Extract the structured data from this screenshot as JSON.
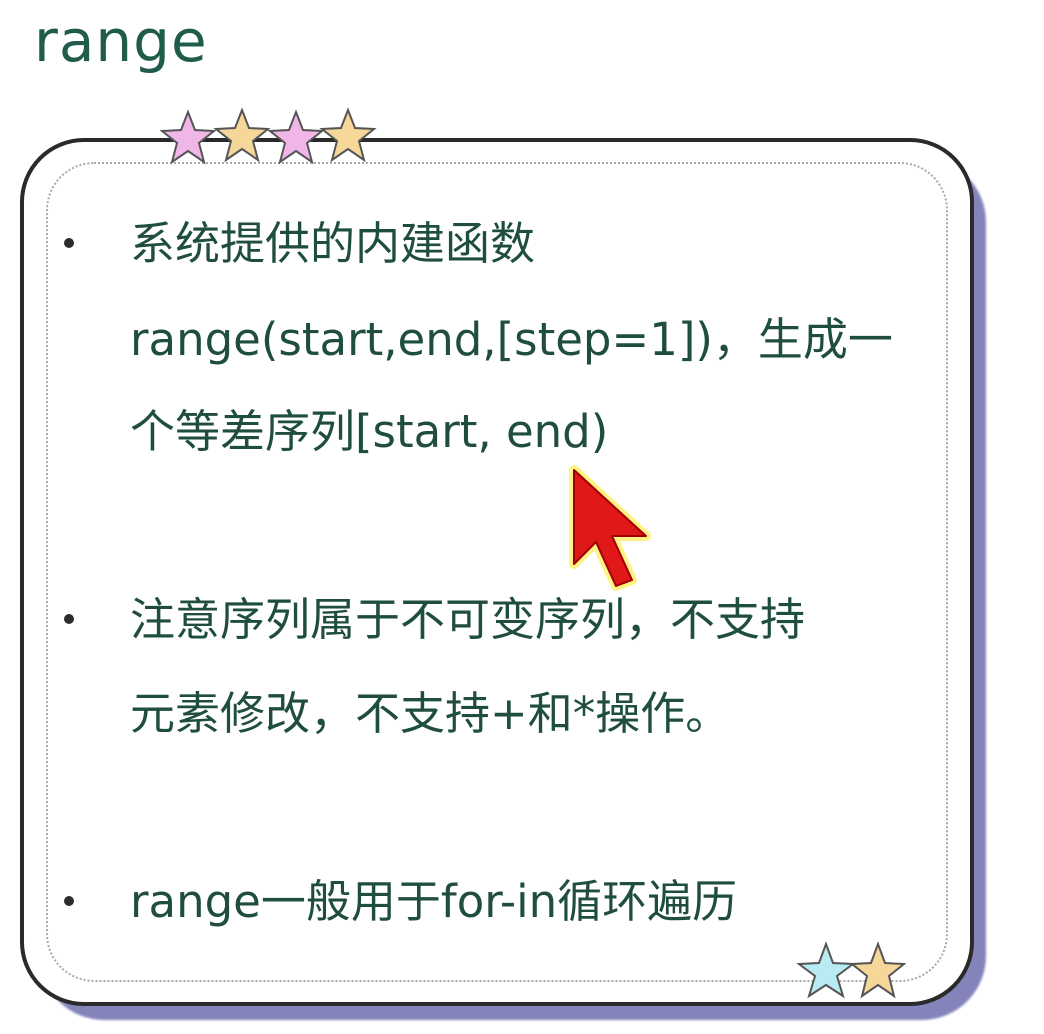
{
  "slide": {
    "title": "range",
    "bullets": [
      {
        "lines": [
          "系统提供的内建函数",
          "range(start,end,[step=1])，生成一",
          "个等差序列[start, end)"
        ]
      },
      {
        "lines": [
          "注意序列属于不可变序列，不支持",
          "元素修改，不支持+和*操作。"
        ]
      },
      {
        "lines": [
          "range一般用于for-in循环遍历"
        ]
      }
    ]
  },
  "colors": {
    "title": "#1f5c4b",
    "text": "#1f4d3f",
    "card_border": "#2a2a2a",
    "card_shadow": "#6f6fb0",
    "star_pink": "#f0b6e8",
    "star_yellow": "#f5d79a",
    "star_cyan": "#b8ecf2",
    "cursor_fill": "#e01818",
    "cursor_glow": "#fff27a"
  },
  "icons": {
    "top_stars": [
      "star-pink-icon",
      "star-yellow-icon",
      "star-pink-icon",
      "star-yellow-icon"
    ],
    "bottom_stars": [
      "star-cyan-icon",
      "star-yellow-icon"
    ],
    "pointer": "mouse-cursor-icon"
  }
}
